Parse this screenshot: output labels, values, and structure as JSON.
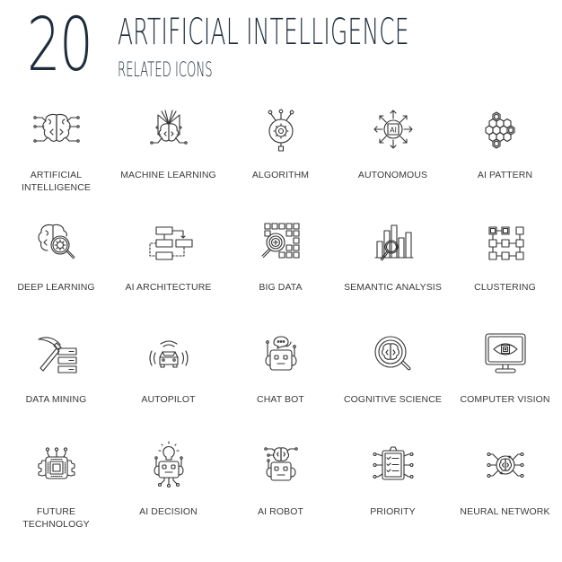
{
  "header": {
    "count": "20",
    "title": "ARTIFICIAL INTELLIGENCE",
    "subtitle": "RELATED ICONS"
  },
  "colors": {
    "heading": "#1e2d3b",
    "icon_stroke": "#333333",
    "label": "#3a3a3a",
    "background": "#ffffff"
  },
  "icons": [
    {
      "name": "artificial-intelligence-icon",
      "label_line1": "ARTIFICIAL",
      "label_line2": "INTELLIGENCE"
    },
    {
      "name": "machine-learning-icon",
      "label_line1": "MACHINE LEARNING",
      "label_line2": ""
    },
    {
      "name": "algorithm-icon",
      "label_line1": "ALGORITHM",
      "label_line2": ""
    },
    {
      "name": "autonomous-icon",
      "label_line1": "AUTONOMOUS",
      "label_line2": "",
      "chip_text": "AI"
    },
    {
      "name": "ai-pattern-icon",
      "label_line1": "AI PATTERN",
      "label_line2": ""
    },
    {
      "name": "deep-learning-icon",
      "label_line1": "DEEP LEARNING",
      "label_line2": ""
    },
    {
      "name": "ai-architecture-icon",
      "label_line1": "AI ARCHITECTURE",
      "label_line2": ""
    },
    {
      "name": "big-data-icon",
      "label_line1": "BIG DATA",
      "label_line2": ""
    },
    {
      "name": "semantic-analysis-icon",
      "label_line1": "SEMANTIC ANALYSIS",
      "label_line2": ""
    },
    {
      "name": "clustering-icon",
      "label_line1": "CLUSTERING",
      "label_line2": ""
    },
    {
      "name": "data-mining-icon",
      "label_line1": "DATA MINING",
      "label_line2": ""
    },
    {
      "name": "autopilot-icon",
      "label_line1": "AUTOPILOT",
      "label_line2": ""
    },
    {
      "name": "chat-bot-icon",
      "label_line1": "CHAT BOT",
      "label_line2": ""
    },
    {
      "name": "cognitive-science-icon",
      "label_line1": "COGNITIVE SCIENCE",
      "label_line2": ""
    },
    {
      "name": "computer-vision-icon",
      "label_line1": "COMPUTER VISION",
      "label_line2": ""
    },
    {
      "name": "future-technology-icon",
      "label_line1": "FUTURE",
      "label_line2": "TECHNOLOGY"
    },
    {
      "name": "ai-decision-icon",
      "label_line1": "AI DECISION",
      "label_line2": ""
    },
    {
      "name": "ai-robot-icon",
      "label_line1": "AI ROBOT",
      "label_line2": ""
    },
    {
      "name": "priority-icon",
      "label_line1": "PRIORITY",
      "label_line2": ""
    },
    {
      "name": "neural-network-icon",
      "label_line1": "NEURAL NETWORK",
      "label_line2": ""
    }
  ]
}
